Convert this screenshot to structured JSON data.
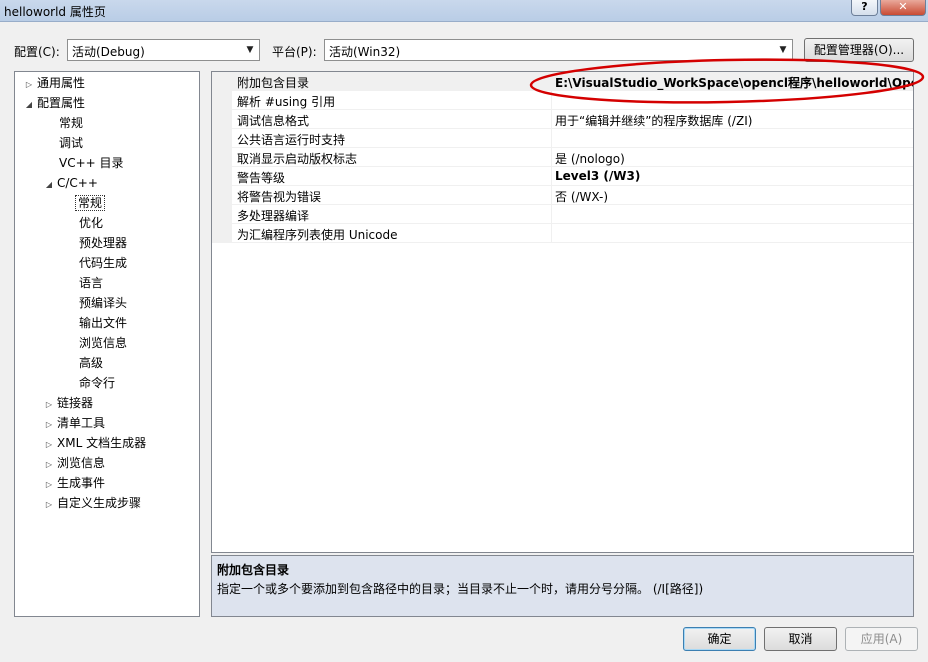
{
  "window": {
    "title": "helloworld 属性页",
    "help_label": "?",
    "close_label": "✕"
  },
  "toolbar": {
    "config_label": "配置(C):",
    "config_value": "活动(Debug)",
    "platform_label": "平台(P):",
    "platform_value": "活动(Win32)",
    "config_manager_label": "配置管理器(O)..."
  },
  "tree": {
    "items": [
      {
        "label": "通用属性",
        "expander": "▷"
      },
      {
        "label": "配置属性",
        "expander": "◢"
      },
      {
        "label": "常规",
        "expander": ""
      },
      {
        "label": "调试",
        "expander": ""
      },
      {
        "label": "VC++ 目录",
        "expander": ""
      },
      {
        "label": "C/C++",
        "expander": "◢"
      },
      {
        "label": "常规",
        "expander": ""
      },
      {
        "label": "优化",
        "expander": ""
      },
      {
        "label": "预处理器",
        "expander": ""
      },
      {
        "label": "代码生成",
        "expander": ""
      },
      {
        "label": "语言",
        "expander": ""
      },
      {
        "label": "预编译头",
        "expander": ""
      },
      {
        "label": "输出文件",
        "expander": ""
      },
      {
        "label": "浏览信息",
        "expander": ""
      },
      {
        "label": "高级",
        "expander": ""
      },
      {
        "label": "命令行",
        "expander": ""
      },
      {
        "label": "链接器",
        "expander": "▷"
      },
      {
        "label": "清单工具",
        "expander": "▷"
      },
      {
        "label": "XML 文档生成器",
        "expander": "▷"
      },
      {
        "label": "浏览信息",
        "expander": "▷"
      },
      {
        "label": "生成事件",
        "expander": "▷"
      },
      {
        "label": "自定义生成步骤",
        "expander": "▷"
      }
    ]
  },
  "properties": [
    {
      "name": "附加包含目录",
      "value": "E:\\VisualStudio_WorkSpace\\opencl程序\\helloworld\\OpenCl"
    },
    {
      "name": "解析 #using 引用",
      "value": ""
    },
    {
      "name": "调试信息格式",
      "value": "用于“编辑并继续”的程序数据库 (/ZI)"
    },
    {
      "name": "公共语言运行时支持",
      "value": ""
    },
    {
      "name": "取消显示启动版权标志",
      "value": "是 (/nologo)"
    },
    {
      "name": "警告等级",
      "value": "Level3 (/W3)"
    },
    {
      "name": "将警告视为错误",
      "value": "否 (/WX-)"
    },
    {
      "name": "多处理器编译",
      "value": ""
    },
    {
      "name": "为汇编程序列表使用 Unicode",
      "value": ""
    }
  ],
  "description": {
    "title": "附加包含目录",
    "text": "指定一个或多个要添加到包含路径中的目录；当目录不止一个时，请用分号分隔。     (/I[路径])"
  },
  "buttons": {
    "ok": "确定",
    "cancel": "取消",
    "apply": "应用(A)"
  },
  "colors": {
    "annotation": "#d40000"
  }
}
